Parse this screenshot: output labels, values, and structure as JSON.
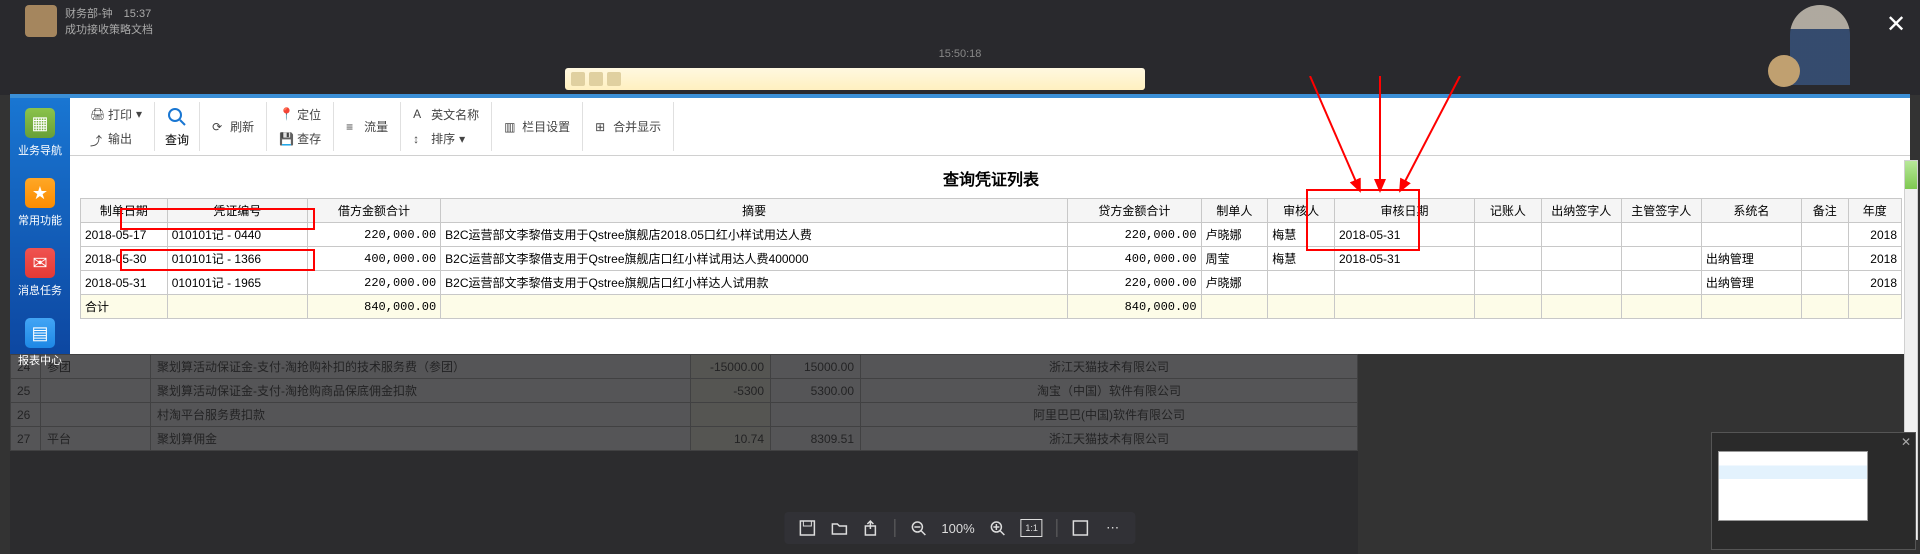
{
  "header": {
    "chat_name": "财务部-钟",
    "chat_time": "15:37",
    "chat_sub": "成功接收策略文档",
    "time_center": "15:50:18"
  },
  "sidebar": {
    "items": [
      {
        "label": "业务导航"
      },
      {
        "label": "常用功能"
      },
      {
        "label": "消息任务"
      },
      {
        "label": "报表中心"
      }
    ]
  },
  "toolbar": {
    "print": "打印",
    "export": "输出",
    "query": "查询",
    "refresh": "刷新",
    "locate": "定位",
    "savequery": "查存",
    "flow": "流量",
    "english": "英文名称",
    "sort": "排序",
    "columns": "栏目设置",
    "merge": "合并显示"
  },
  "table": {
    "title": "查询凭证列表",
    "headers": [
      "制单日期",
      "凭证编号",
      "借方金额合计",
      "摘要",
      "贷方金额合计",
      "制单人",
      "审核人",
      "审核日期",
      "记账人",
      "出纳签字人",
      "主管签字人",
      "系统名",
      "备注",
      "年度"
    ],
    "rows": [
      {
        "date": "2018-05-17",
        "vno": "010101记 - 0440",
        "debit": "220,000.00",
        "summary": "B2C运营部文李黎借支用于Qstree旗舰店2018.05口红小样试用达人费",
        "credit": "220,000.00",
        "maker": "卢晓娜",
        "auditor": "梅慧",
        "adate": "2018-05-31",
        "poster": "",
        "cashier": "",
        "supervisor": "",
        "sys": "",
        "remark": "",
        "year": "2018"
      },
      {
        "date": "2018-05-30",
        "vno": "010101记 - 1366",
        "debit": "400,000.00",
        "summary": "B2C运营部文李黎借支用于Qstree旗舰店口红小样试用达人费400000",
        "credit": "400,000.00",
        "maker": "周莹",
        "auditor": "梅慧",
        "adate": "2018-05-31",
        "poster": "",
        "cashier": "",
        "supervisor": "",
        "sys": "出纳管理",
        "remark": "",
        "year": "2018"
      },
      {
        "date": "2018-05-31",
        "vno": "010101记 - 1965",
        "debit": "220,000.00",
        "summary": "B2C运营部文李黎借支用于Qstree旗舰店口红小样达人试用款",
        "credit": "220,000.00",
        "maker": "卢晓娜",
        "auditor": "",
        "adate": "",
        "poster": "",
        "cashier": "",
        "supervisor": "",
        "sys": "出纳管理",
        "remark": "",
        "year": "2018"
      }
    ],
    "sum_label": "合计",
    "sum_debit": "840,000.00",
    "sum_credit": "840,000.00"
  },
  "bg_table": {
    "rows": [
      {
        "no": "24",
        "c1": "参团",
        "c2": "聚划算活动保证金-支付-淘抢购补扣的技术服务费（参团）",
        "c3": "-15000.00",
        "c4": "15000.00",
        "c5": "浙江天猫技术有限公司"
      },
      {
        "no": "25",
        "c1": "",
        "c2": "聚划算活动保证金-支付-淘抢购商品保底佣金扣款",
        "c3": "-5300",
        "c4": "5300.00",
        "c5": "淘宝（中国）软件有限公司"
      },
      {
        "no": "26",
        "c1": "",
        "c2": "村淘平台服务费扣款",
        "c3": "",
        "c4": "",
        "c5": "阿里巴巴(中国)软件有限公司"
      },
      {
        "no": "27",
        "c1": "平台",
        "c2": "聚划算佣金",
        "c3": "10.74",
        "c4": "8309.51",
        "c5": "浙江天猫技术有限公司"
      }
    ]
  },
  "viewer": {
    "zoom": "100%"
  }
}
